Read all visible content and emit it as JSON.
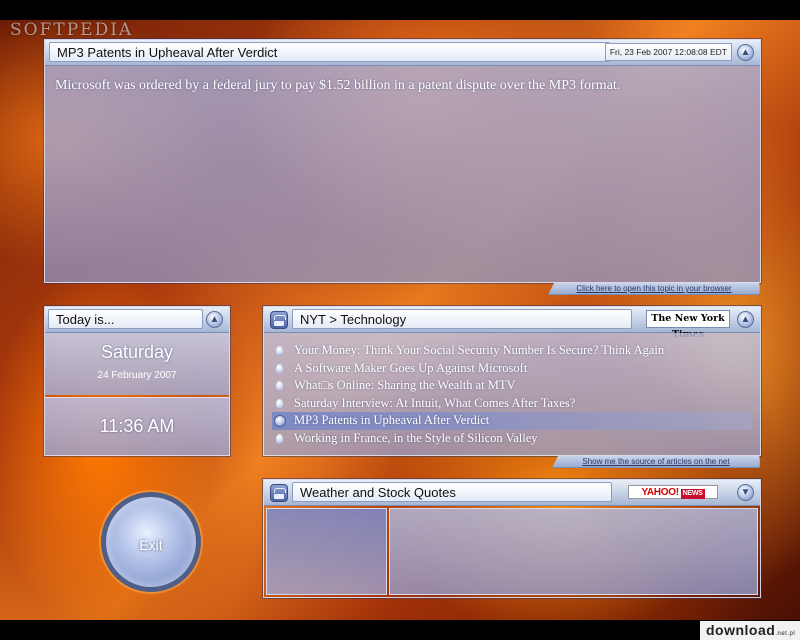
{
  "watermark": "SOFTPEDIA",
  "download_logo": {
    "brand": "download",
    "suffix": ".net.pl"
  },
  "article": {
    "title": "MP3 Patents in Upheaval After Verdict",
    "date": "Fri, 23 Feb 2007 12:08:08 EDT",
    "text": "Microsoft was ordered by a federal jury to pay $1.52 billion in a patent dispute over the MP3 format.",
    "footer_link": "Click here to open this topic in your browser"
  },
  "today": {
    "title": "Today is...",
    "day": "Saturday",
    "date": "24 February 2007",
    "time": "11:36 AM"
  },
  "nyt": {
    "title": "NYT > Technology",
    "logo": "The New York Times",
    "items": [
      "Your Money: Think Your Social Security Number Is Secure? Think Again",
      "A Software Maker Goes Up Against Microsoft",
      "What□s Online: Sharing the Wealth at MTV",
      "Saturday Interview: At Intuit, What Comes After Taxes?",
      "MP3 Patents in Upheaval After Verdict",
      "Working in France, in the Style of Silicon Valley"
    ],
    "selected_index": 4,
    "footer_link": "Show me the source of articles on the net"
  },
  "weather": {
    "title": "Weather and Stock Quotes",
    "logo": "YAHOO!",
    "logo_suffix": "NEWS"
  },
  "exit_label": "Exit",
  "icons": {
    "panel_button": "up-arrow-icon",
    "rss": "rss-feed-icon",
    "bullet": "bullet-orb-icon"
  },
  "colors": {
    "panel_header": "#c4d0e6",
    "panel_border": "#dce6ff",
    "text_light": "#ffffff",
    "background_warm": "#f08020"
  }
}
